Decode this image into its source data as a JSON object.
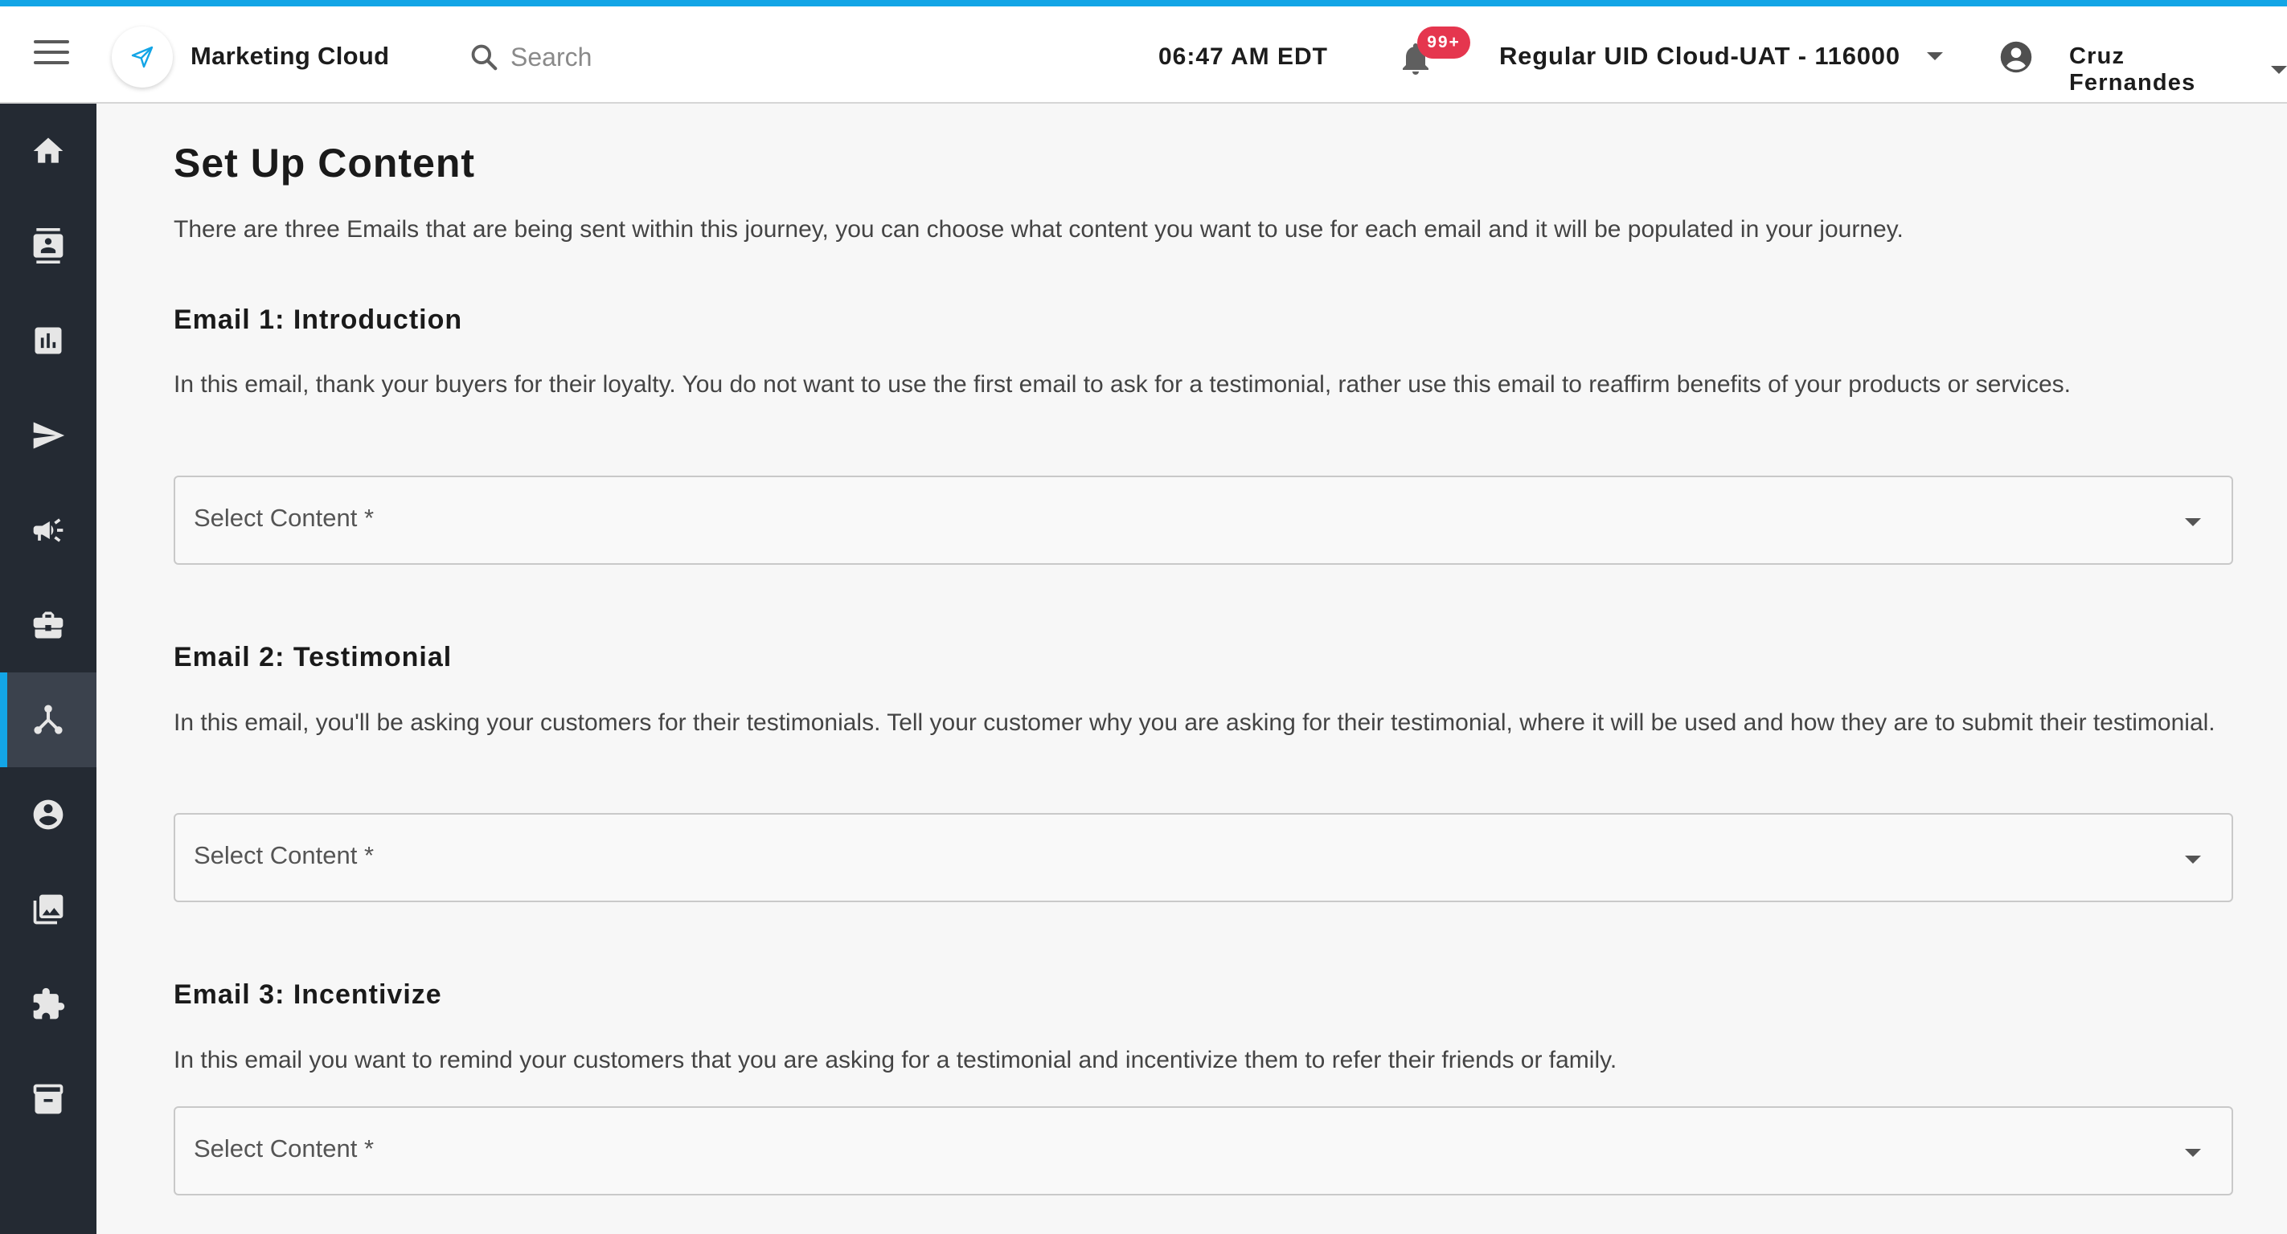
{
  "header": {
    "app_title": "Marketing Cloud",
    "search_placeholder": "Search",
    "time": "06:47 AM EDT",
    "notification_count": "99+",
    "account_name": "Regular UID Cloud-UAT - 116000",
    "user_name": "Cruz Fernandes"
  },
  "sidebar": {
    "items": [
      {
        "icon": "home-icon"
      },
      {
        "icon": "contacts-icon"
      },
      {
        "icon": "analytics-icon"
      },
      {
        "icon": "send-icon"
      },
      {
        "icon": "megaphone-icon"
      },
      {
        "icon": "briefcase-icon"
      },
      {
        "icon": "journey-icon",
        "active": true
      },
      {
        "icon": "account-circle-icon"
      },
      {
        "icon": "image-library-icon"
      },
      {
        "icon": "puzzle-icon"
      },
      {
        "icon": "archive-icon"
      }
    ]
  },
  "main": {
    "title": "Set Up Content",
    "description": "There are three Emails that are being sent within this journey, you can choose what content you want to use for each email and it will be populated in your journey.",
    "sections": [
      {
        "title": "Email 1: Introduction",
        "description": "In this email, thank your buyers for their loyalty. You do not want to use the first email to ask for a testimonial, rather use this email to reaffirm benefits of your products or services.",
        "select_label": "Select Content *"
      },
      {
        "title": "Email 2: Testimonial",
        "description": "In this email, you'll be asking your customers for their testimonials. Tell your customer why you are asking for their testimonial, where it will be used and how they are to submit their testimonial.",
        "select_label": "Select Content *"
      },
      {
        "title": "Email 3: Incentivize",
        "description": "In this email you want to remind your customers that you are asking for a testimonial and incentivize them to refer their friends or family.",
        "select_label": "Select Content *"
      }
    ]
  },
  "colors": {
    "accent": "#13a5e6",
    "sidebar_bg": "#242a33",
    "sidebar_active": "#3b424d",
    "badge": "#e5364e"
  }
}
